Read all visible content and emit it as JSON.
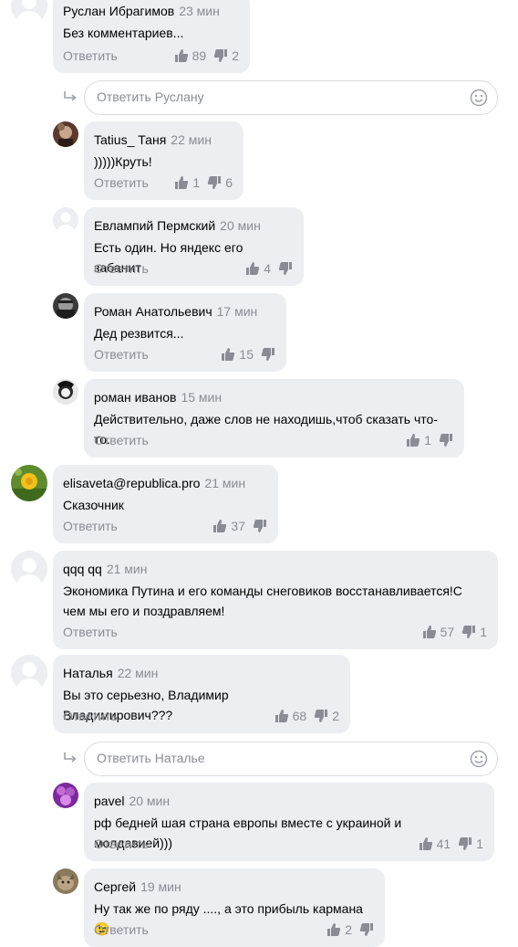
{
  "reply_label": "Ответить",
  "comments": [
    {
      "author": "Руслан Ибрагимов",
      "time": "23 мин",
      "text": "Без комментариев...",
      "likes": "89",
      "dislikes": "2"
    },
    {
      "author": "Tatius_ Таня",
      "time": "22 мин",
      "text": ")))))Круть!",
      "likes": "1",
      "dislikes": "6"
    },
    {
      "author": "Евлампий Пермский",
      "time": "20 мин",
      "text": "Есть один. Но яндекс его забанит",
      "likes": "4",
      "dislikes": ""
    },
    {
      "author": "Роман Анатольевич",
      "time": "17 мин",
      "text": "Дед резвится...",
      "likes": "15",
      "dislikes": ""
    },
    {
      "author": "роман иванов",
      "time": "15 мин",
      "text": "Действительно, даже слов не находишь,чтоб сказать что-то.",
      "likes": "1",
      "dislikes": ""
    },
    {
      "author": "elisaveta@republica.pro",
      "time": "21 мин",
      "text": "Сказочник",
      "likes": "37",
      "dislikes": ""
    },
    {
      "author": "qqq qq",
      "time": "21 мин",
      "text": "Экономика Путина и его команды снеговиков восстанавливается!С чем мы его и поздравляем!",
      "likes": "57",
      "dislikes": "1"
    },
    {
      "author": "Наталья",
      "time": "22 мин",
      "text": "Вы это серьезно, Владимир Владимирович???",
      "likes": "68",
      "dislikes": "2"
    },
    {
      "author": "pavel",
      "time": "20 мин",
      "text": "рф бедней шая страна европы вместе с украиной и молдавией)))",
      "likes": "41",
      "dislikes": "1"
    },
    {
      "author": "Сергей",
      "time": "19 мин",
      "text": "Ну так же по ряду ...., а это прибыль кармана 😉",
      "likes": "2",
      "dislikes": ""
    }
  ],
  "reply_boxes": [
    {
      "placeholder": "Ответить Руслану"
    },
    {
      "placeholder": "Ответить Наталье"
    }
  ]
}
